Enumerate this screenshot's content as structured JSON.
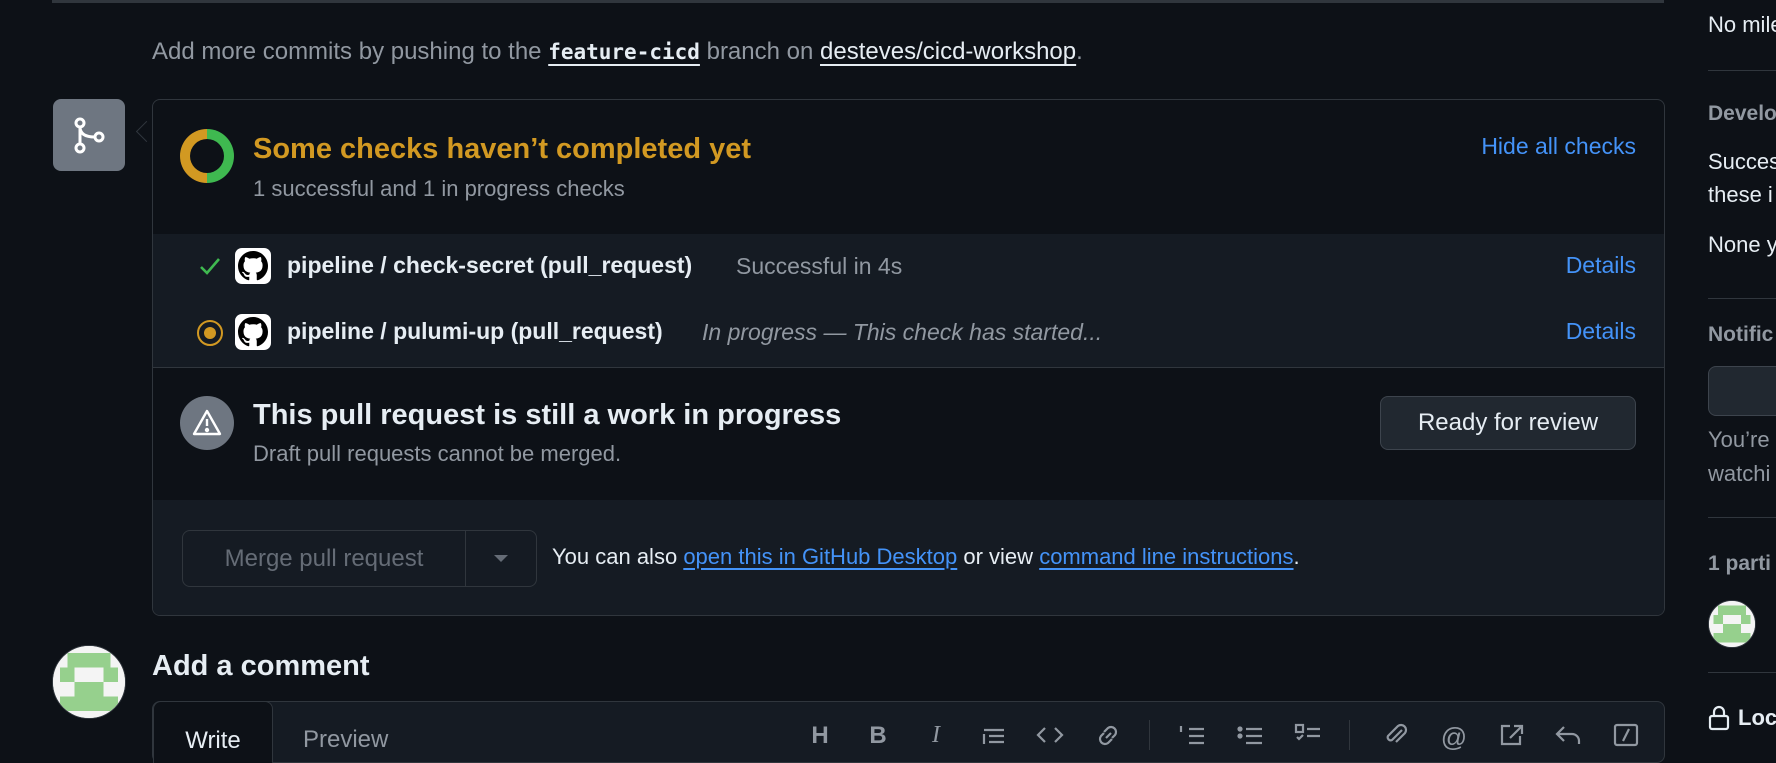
{
  "commit_hint": {
    "prefix": "Add more commits by pushing to the",
    "branch": "feature-cicd",
    "middle": "branch on",
    "repo": "desteves/cicd-workshop",
    "suffix": "."
  },
  "checks": {
    "title": "Some checks haven’t completed yet",
    "subtitle": "1 successful and 1 in progress checks",
    "hide_label": "Hide all checks",
    "items": [
      {
        "name": "pipeline / check-secret (pull_request)",
        "description": "Successful in 4s",
        "status": "success",
        "details_label": "Details"
      },
      {
        "name": "pipeline / pulumi-up (pull_request)",
        "description": "In progress — This check has started...",
        "status": "in-progress",
        "details_label": "Details"
      }
    ]
  },
  "wip": {
    "title": "This pull request is still a work in progress",
    "subtitle": "Draft pull requests cannot be merged.",
    "ready_button": "Ready for review"
  },
  "merge": {
    "button_label": "Merge pull request",
    "note_prefix": "You can also",
    "desktop_link": "open this in GitHub Desktop",
    "note_middle": "or view",
    "cli_link": "command line instructions",
    "note_suffix": "."
  },
  "comment": {
    "heading": "Add a comment",
    "tab_write": "Write",
    "tab_preview": "Preview",
    "toolbar_icons": [
      "heading-icon",
      "bold-icon",
      "italic-icon",
      "quote-icon",
      "code-icon",
      "link-icon",
      "ordered-list-icon",
      "unordered-list-icon",
      "task-list-icon",
      "attach-icon",
      "mention-icon",
      "cross-reference-icon",
      "saved-reply-icon",
      "slash-command-icon"
    ]
  },
  "sidebar": {
    "milestone_text": "No mile",
    "development_heading": "Develo",
    "development_text_1": "Succes",
    "development_text_2": "these i",
    "development_none": "None y",
    "notifications_heading": "Notific",
    "notifications_text_1": "You’re",
    "notifications_text_2": "watchi",
    "participants_heading": "1 parti",
    "lock_text": "Loc"
  },
  "colors": {
    "background": "#0d1117",
    "border": "#30363d",
    "success": "#3fb950",
    "pending": "#d29922",
    "link": "#4493f8"
  }
}
